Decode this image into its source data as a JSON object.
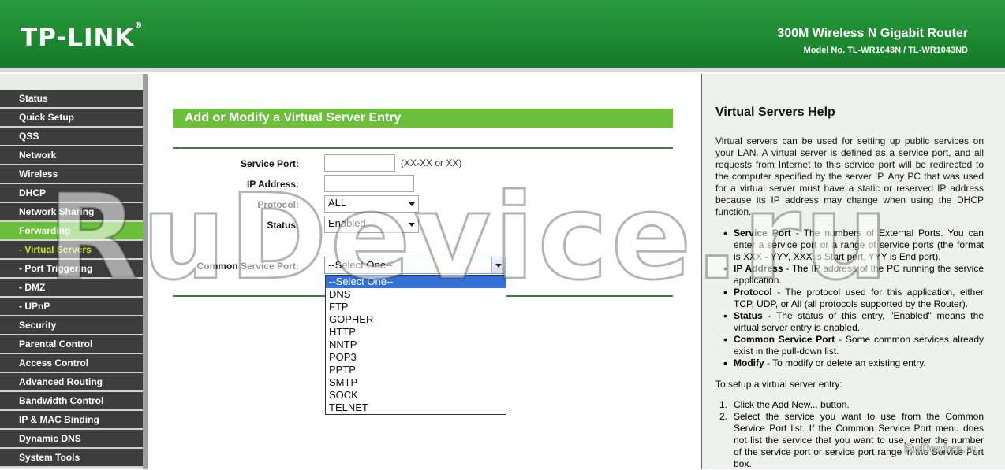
{
  "header": {
    "logo": "TP-LINK",
    "logo_reg": "®",
    "product": "300M Wireless N Gigabit Router",
    "model": "Model No. TL-WR1043N / TL-WR1043ND"
  },
  "sidebar": {
    "items": [
      {
        "label": "Status"
      },
      {
        "label": "Quick Setup"
      },
      {
        "label": "QSS"
      },
      {
        "label": "Network"
      },
      {
        "label": "Wireless"
      },
      {
        "label": "DHCP"
      },
      {
        "label": "Network Sharing"
      },
      {
        "label": "Forwarding"
      },
      {
        "label": "- Virtual Servers"
      },
      {
        "label": "- Port Triggering"
      },
      {
        "label": "- DMZ"
      },
      {
        "label": "- UPnP"
      },
      {
        "label": "Security"
      },
      {
        "label": "Parental Control"
      },
      {
        "label": "Access Control"
      },
      {
        "label": "Advanced Routing"
      },
      {
        "label": "Bandwidth Control"
      },
      {
        "label": "IP & MAC Binding"
      },
      {
        "label": "Dynamic DNS"
      },
      {
        "label": "System Tools"
      }
    ]
  },
  "form": {
    "title": "Add or Modify a Virtual Server Entry",
    "service_port_label": "Service Port:",
    "service_port_value": "",
    "service_port_hint": "(XX-XX or XX)",
    "ip_label": "IP Address:",
    "ip_value": "",
    "protocol_label": "Protocol:",
    "protocol_value": "ALL",
    "status_label": "Status:",
    "status_value": "Enabled",
    "csp_label": "Common Service Port:",
    "csp_value": "--Select One--",
    "csp_options": [
      "--Select One--",
      "DNS",
      "FTP",
      "GOPHER",
      "HTTP",
      "NNTP",
      "POP3",
      "PPTP",
      "SMTP",
      "SOCK",
      "TELNET"
    ]
  },
  "help": {
    "title": "Virtual Servers Help",
    "intro": "Virtual servers can be used for setting up public services on your LAN. A virtual server is defined as a service port, and all requests from Internet to this service port will be redirected to the computer specified by the server IP. Any PC that was used for a virtual server must have a static or reserved IP address because its IP address may change when using the DHCP function.",
    "items": [
      {
        "term": "Service Port",
        "text": " - The numbers of External Ports. You can enter a service port or a range of service ports (the format is XXX - YYY, XXX is Start port, YYY is End port)."
      },
      {
        "term": "IP Address",
        "text": " - The IP address of the PC running the service application."
      },
      {
        "term": "Protocol",
        "text": " - The protocol used for this application, either TCP, UDP, or All (all protocols supported by the Router)."
      },
      {
        "term": "Status",
        "text": " - The status of this entry, \"Enabled\" means the virtual server entry is enabled."
      },
      {
        "term": "Common Service Port",
        "text": " - Some common services already exist in the pull-down list."
      },
      {
        "term": "Modify",
        "text": " - To modify or delete an existing entry."
      }
    ],
    "setup_title": "To setup a virtual server entry:",
    "steps": [
      {
        "num": "1.",
        "text": "Click the Add New... button."
      },
      {
        "num": "2.",
        "text": "Select the service you want to use from the Common Service Port list. If the Common Service Port menu does not list the service that you want to use, enter the number of the service port or service port range in the Service Port box."
      }
    ]
  },
  "watermark": "RuDevice.ru",
  "watermark_small": "RuDevice.ru",
  "colors": {
    "brand_green": "#1f8a32",
    "accent_green": "#6bbf3a",
    "menu_dark": "#3d3d3d",
    "select_blue": "#3470d8"
  }
}
